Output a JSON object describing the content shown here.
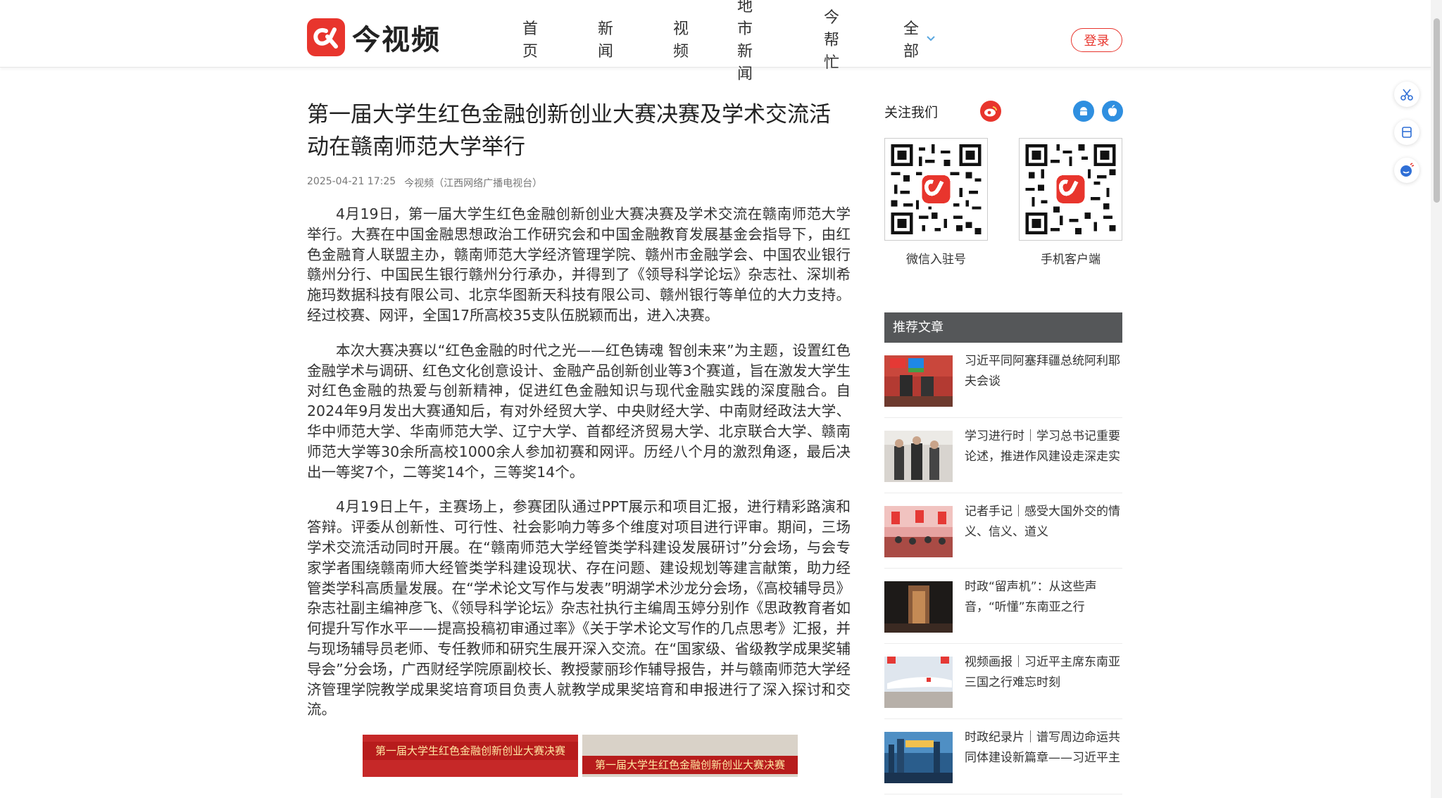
{
  "brand": {
    "name": "今视频",
    "accent": "#e8352d"
  },
  "nav": {
    "items": [
      {
        "label": "首页"
      },
      {
        "label": "新闻"
      },
      {
        "label": "视频"
      },
      {
        "label": "地市新闻"
      },
      {
        "label": "今帮忙"
      },
      {
        "label": "全部"
      }
    ],
    "login_label": "登录"
  },
  "article": {
    "title": "第一届大学生红色金融创新创业大赛决赛及学术交流活动在赣南师范大学举行",
    "date": "2025-04-21 17:25",
    "source": "今视频（江西网络广播电视台）",
    "paragraphs": [
      "4月19日，第一届大学生红色金融创新创业大赛决赛及学术交流在赣南师范大学举行。大赛在中国金融思想政治工作研究会和中国金融教育发展基金会指导下，由红色金融育人联盟主办，赣南师范大学经济管理学院、赣州市金融学会、中国农业银行赣州分行、中国民生银行赣州分行承办，并得到了《领导科学论坛》杂志社、深圳希施玛数据科技有限公司、北京华图新天科技有限公司、赣州银行等单位的大力支持。经过校赛、网评，全国17所高校35支队伍脱颖而出，进入决赛。",
      "本次大赛决赛以“红色金融的时代之光——红色铸魂 智创未来”为主题，设置红色金融学术与调研、红色文化创意设计、金融产品创新创业等3个赛道，旨在激发大学生对红色金融的热爱与创新精神，促进红色金融知识与现代金融实践的深度融合。自2024年9月发出大赛通知后，有对外经贸大学、中央财经大学、中南财经政法大学、华中师范大学、华南师范大学、辽宁大学、首都经济贸易大学、北京联合大学、赣南师范大学等30余所高校1000余人参加初赛和网评。历经八个月的激烈角逐，最后决出一等奖7个，二等奖14个，三等奖14个。",
      "4月19日上午，主赛场上，参赛团队通过PPT展示和项目汇报，进行精彩路演和答辩。评委从创新性、可行性、社会影响力等多个维度对项目进行评审。期间，三场学术交流活动同时开展。在“赣南师范大学经管类学科建设发展研讨”分会场，与会专家学者围绕赣南师大经管类学科建设现状、存在问题、建设规划等建言献策，助力经管类学科高质量发展。在“学术论文写作与发表”明湖学术沙龙分会场，《高校辅导员》杂志社副主编神彦飞、《领导科学论坛》杂志社执行主编周玉婷分别作《思政教育者如何提升写作水平——提高投稿初审通过率》《关于学术论文写作的几点思考》汇报，并与现场辅导员老师、专任教师和研究生展开深入交流。在“国家级、省级教学成果奖辅导会”分会场，广西财经学院原副校长、教授蒙丽珍作辅导报告，并与赣南师范大学经济管理学院教学成果奖培育项目负责人就教学成果奖培育和申报进行了深入探讨和交流。"
    ],
    "image_banners": [
      "第一届大学生红色金融创新创业大赛决赛",
      "第一届大学生红色金融创新创业大赛决赛"
    ]
  },
  "sidebar": {
    "follow_title": "关注我们",
    "icons": [
      "weibo-icon",
      "android-icon",
      "apple-icon"
    ],
    "qr": [
      {
        "caption": "微信入驻号"
      },
      {
        "caption": "手机客户端"
      }
    ],
    "recommend_title": "推荐文章",
    "recommend": [
      {
        "title": "习近平同阿塞拜疆总统阿利耶夫会谈"
      },
      {
        "title": "学习进行时｜学习总书记重要论述，推进作风建设走深走实"
      },
      {
        "title": "记者手记｜感受大国外交的情义、信义、道义"
      },
      {
        "title": "时政“留声机”：从这些声音，“听懂”东南亚之行"
      },
      {
        "title": "视频画报｜习近平主席东南亚三国之行难忘时刻"
      },
      {
        "title": "时政纪录片｜谱写周边命运共同体建设新篇章——习近平主"
      }
    ]
  },
  "tools": [
    "scissors-icon",
    "bookmark-icon",
    "chat-bot-icon"
  ]
}
